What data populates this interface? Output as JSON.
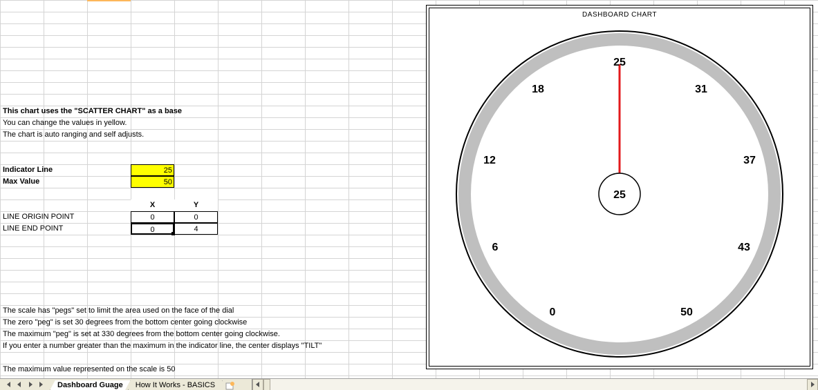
{
  "text": {
    "heading1": "This chart uses the \"SCATTER CHART\" as a base",
    "line2": "You can change the values in yellow.",
    "line3": "The chart is auto ranging and self adjusts.",
    "indicator_label": "Indicator Line",
    "max_label": "Max Value",
    "indicator_value": "25",
    "max_value": "50",
    "col_x": "X",
    "col_y": "Y",
    "row_origin": "LINE ORIGIN POINT",
    "row_end": "LINE END POINT",
    "ox": "0",
    "oy": "0",
    "ex": "0",
    "ey": "4",
    "para1": "The scale has \"pegs\" set to limit the area used on the face of the dial",
    "para2": "The zero \"peg\" is set 30 degrees from the bottom center going clockwise",
    "para3": "The maximum \"peg\" is set at 330 degrees from the bottom center going clockwise.",
    "para4": "If you enter a number greater than the maximum in the indicator line, the center displays \"TILT\"",
    "para5": "The maximum value represented on the scale is 50"
  },
  "chart": {
    "title": "DASHBOARD CHART",
    "center_value": "25"
  },
  "chart_data": {
    "type": "scatter",
    "title": "DASHBOARD CHART",
    "gauge_ticks": [
      {
        "label": "0",
        "angle_deg_from_bottom": 30
      },
      {
        "label": "6",
        "angle_deg_from_bottom": 67.5
      },
      {
        "label": "12",
        "angle_deg_from_bottom": 105
      },
      {
        "label": "18",
        "angle_deg_from_bottom": 142.5
      },
      {
        "label": "25",
        "angle_deg_from_bottom": 180
      },
      {
        "label": "31",
        "angle_deg_from_bottom": 217.5
      },
      {
        "label": "37",
        "angle_deg_from_bottom": 255
      },
      {
        "label": "43",
        "angle_deg_from_bottom": 292.5
      },
      {
        "label": "50",
        "angle_deg_from_bottom": 330
      }
    ],
    "min": 0,
    "max": 50,
    "indicator_value": 25,
    "needle_points": {
      "x": [
        0,
        0
      ],
      "y": [
        0,
        4
      ]
    },
    "center_display": "25"
  },
  "tabs": {
    "active": "Dashboard Guage",
    "other": "How It Works - BASICS"
  }
}
